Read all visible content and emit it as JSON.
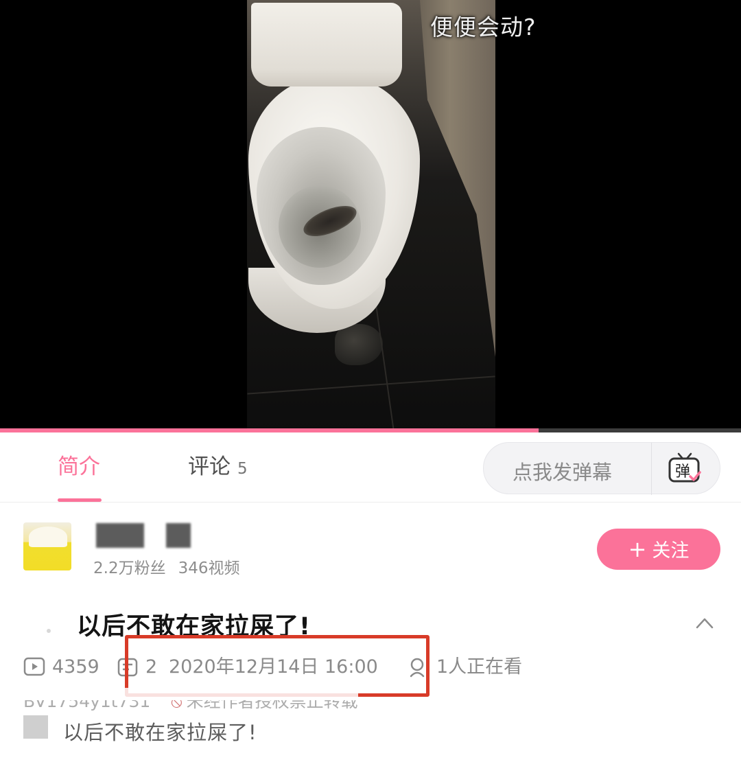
{
  "video": {
    "caption": "便便会动?",
    "progress": 0.727
  },
  "tabs": {
    "intro_label": "简介",
    "comments_label": "评论",
    "comments_count": "5",
    "danmaku_placeholder": "点我发弹幕",
    "danmaku_icon_glyph": "弹"
  },
  "uploader": {
    "followers": "2.2万粉丝",
    "videos": "346视频",
    "follow_label": "关注",
    "follow_plus": "+"
  },
  "video_info": {
    "title": "以后不敢在家拉屎了!",
    "plays": "4359",
    "danmaku_count": "2",
    "publish_time": "2020年12月14日 16:00",
    "watching": "1人正在看",
    "bv_id": "BV1754y1t731",
    "copyright_notice": "未经作者授权禁止转载",
    "description": "以后不敢在家拉屎了!"
  },
  "colors": {
    "accent": "#fb7299",
    "highlight_box": "#d83b28"
  },
  "icons": [
    "play-count-icon",
    "danmaku-count-icon",
    "watching-icon",
    "forbidden-icon",
    "chevron-up-icon",
    "danmaku-tv-icon"
  ]
}
